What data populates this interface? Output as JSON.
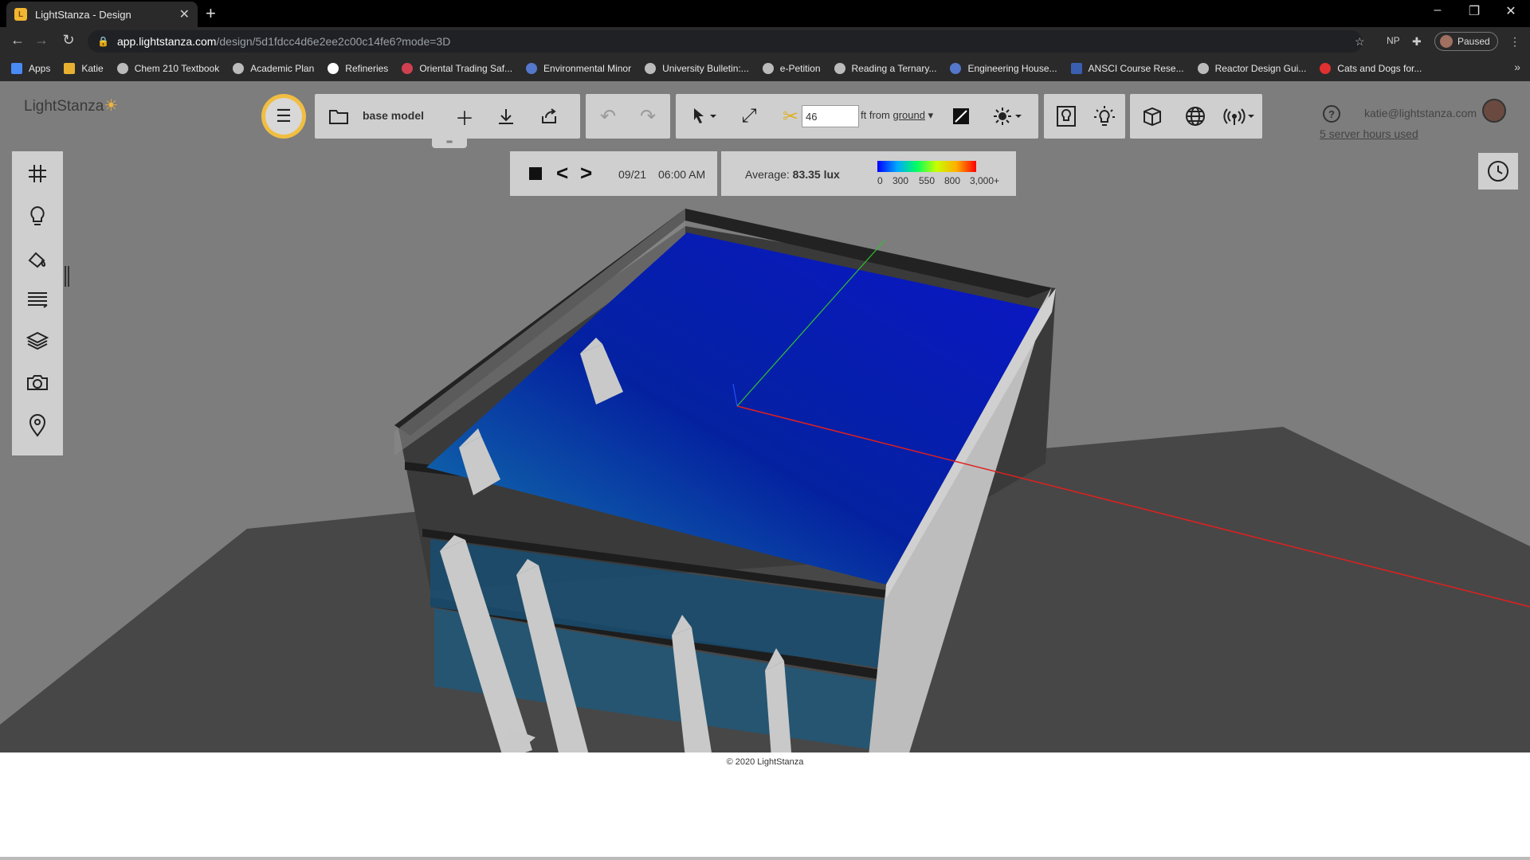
{
  "browser": {
    "tab_title": "LightStanza - Design",
    "url_domain": "app.lightstanza.com",
    "url_path": "/design/5d1fdcc4d6e2ee2c00c14fe6?mode=3D",
    "profile_initials": "NP",
    "profile_status": "Paused",
    "bookmarks": [
      "Apps",
      "Katie",
      "Chem 210 Textbook",
      "Academic Plan",
      "Refineries",
      "Oriental Trading Saf...",
      "Environmental Minor",
      "University Bulletin:...",
      "e-Petition",
      "Reading a Ternary...",
      "Engineering House...",
      "ANSCI Course Rese...",
      "Reactor Design Gui...",
      "Cats and Dogs for..."
    ]
  },
  "app": {
    "logo": "LightStanza",
    "model_name": "base model",
    "plane_height": "46",
    "plane_height_suffix": "ft from",
    "plane_height_ref": "ground",
    "user_email": "katie@lightstanza.com",
    "server_hours": "5 server hours used",
    "footer": "© 2020 LightStanza"
  },
  "simulation": {
    "date": "09/21",
    "time": "06:00 AM",
    "average_label": "Average:",
    "average_value": "83.35 lux",
    "legend_ticks": [
      "0",
      "300",
      "550",
      "800",
      "3,000+"
    ],
    "legend_colors": [
      "#0000ff",
      "#00a8ff",
      "#00ff60",
      "#c8ff00",
      "#ffae00",
      "#ff0000"
    ]
  },
  "icons": {
    "toolbar": [
      "library-icon",
      "folder-icon",
      "plus-icon",
      "download-icon",
      "share-icon",
      "undo-icon",
      "redo-icon",
      "select-arrow-icon",
      "expand-icon",
      "scissors-icon",
      "plane-icon",
      "sun-cursor-icon",
      "lamp-icon",
      "light-bulb-rays-icon",
      "cube-icon",
      "globe-icon",
      "radiance-icon"
    ],
    "sidebar": [
      "grid-icon",
      "lightbulb-icon",
      "material-bucket-icon",
      "layers-lines-icon",
      "layers-icon",
      "camera-icon",
      "location-pin-icon"
    ],
    "corner": "clock-icon"
  }
}
